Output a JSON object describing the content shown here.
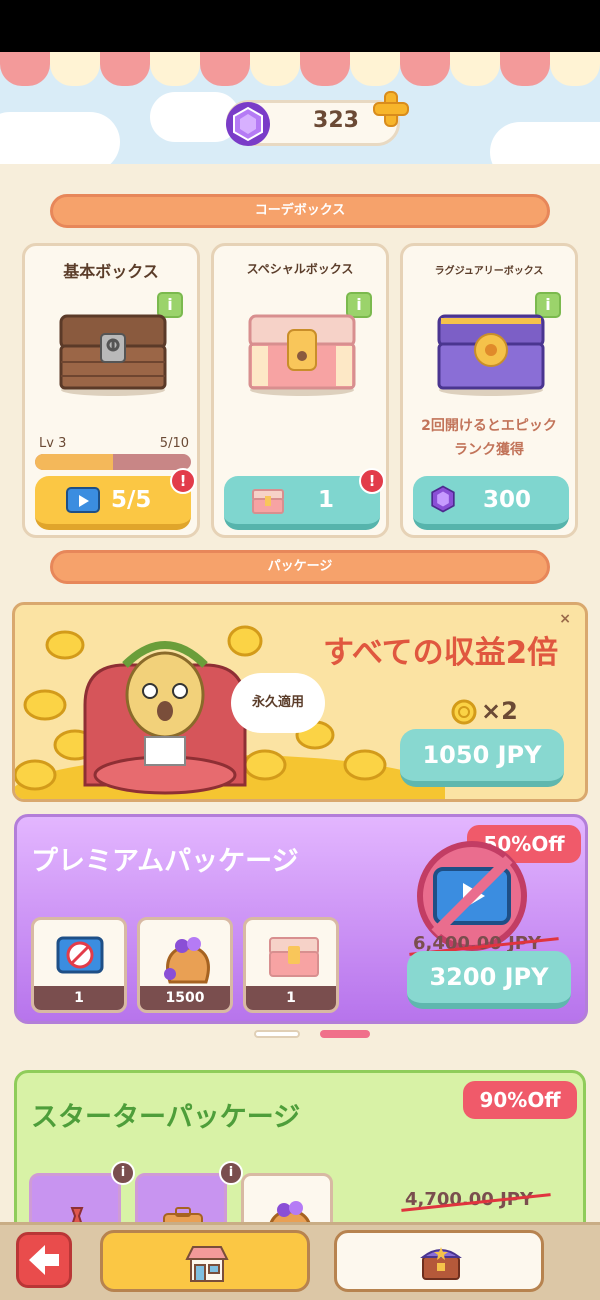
{
  "header": {
    "gem_count": "323"
  },
  "sections": {
    "code_box": "コーデボックス",
    "package": "パッケージ"
  },
  "boxes": [
    {
      "title": "基本ボックス",
      "level": "Lv 3",
      "progress_text": "5/10",
      "progress": 0.5,
      "button_label": "5/5",
      "alert": "!",
      "info": "i"
    },
    {
      "title": "スペシャルボックス",
      "button_label": "1",
      "alert": "!",
      "info": "i"
    },
    {
      "title": "ラグジュアリーボックス",
      "description_line1": "2回開けるとエピック",
      "description_line2": "ランク獲得",
      "button_label": "300",
      "info": "i"
    }
  ],
  "promo": {
    "title": "すべての収益2倍",
    "speech": "永久適用",
    "multiplier": "×2",
    "price": "1050 JPY",
    "close": "×"
  },
  "premium": {
    "title": "プレミアムパッケージ",
    "discount": "50%Off",
    "original_price": "6,400.00 JPY",
    "price": "3200 JPY",
    "items": [
      {
        "count": "1"
      },
      {
        "count": "1500"
      },
      {
        "count": "1"
      }
    ]
  },
  "starter": {
    "title": "スターターパッケージ",
    "discount": "90%Off",
    "original_price": "4,700.00 JPY",
    "info": "i"
  },
  "colors": {
    "accent_orange": "#f6a26b",
    "teal": "#88d8d0",
    "yellow": "#fbc744",
    "purple": "#b774ec",
    "green": "#d8f2a6",
    "sale_red": "#f05a6a"
  }
}
